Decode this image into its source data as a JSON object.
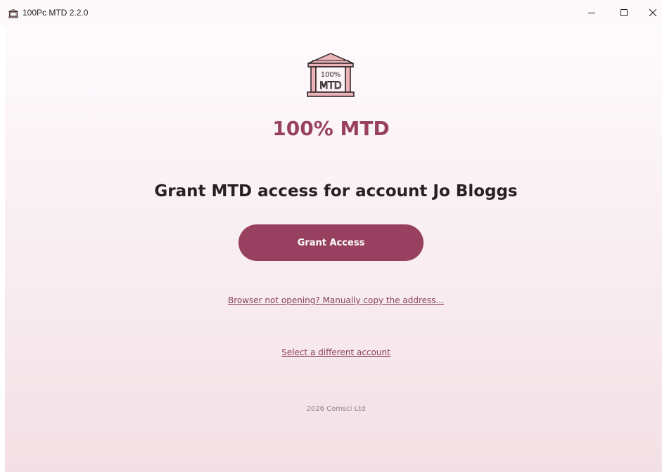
{
  "window": {
    "title": "100Pc MTD 2.2.0",
    "controls": {
      "minimize": "minimize-icon",
      "maximize": "maximize-icon",
      "close": "close-icon"
    }
  },
  "logo": {
    "line1": "100%",
    "line2": "MTD",
    "icon": "bank-building-icon"
  },
  "main": {
    "brand_title": "100% MTD",
    "heading": "Grant MTD access for account Jo Bloggs",
    "grant_button_label": "Grant Access",
    "copy_address_link": "Browser not opening? Manually copy the address...",
    "select_account_link": "Select a different account",
    "footer": "2026 Comsci Ltd"
  },
  "colors": {
    "accent": "#97405f",
    "logo_fill": "#eab4b8",
    "background_top": "#fefbfd",
    "background_bottom": "#f3e0e5"
  }
}
